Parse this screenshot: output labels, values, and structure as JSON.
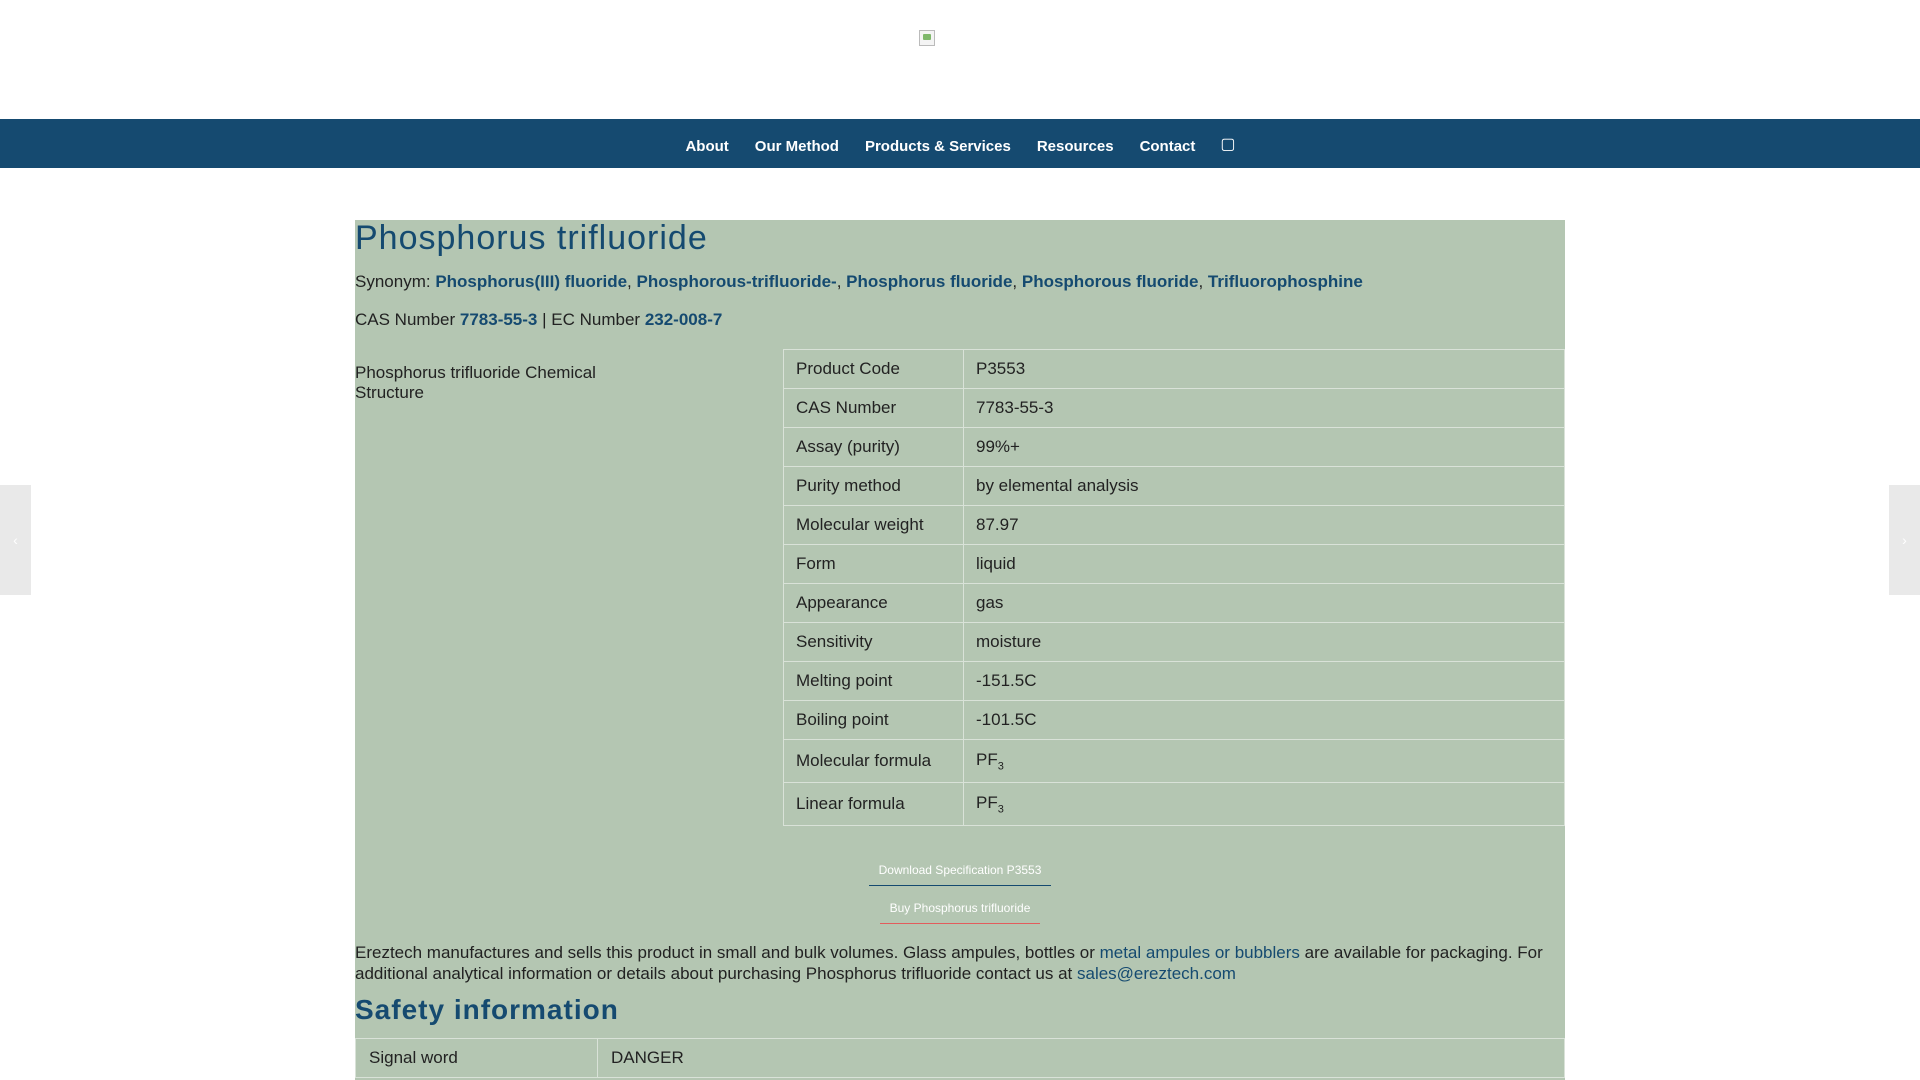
{
  "header": {
    "logo_icon": "broken-image-icon"
  },
  "nav": {
    "items": [
      "About",
      "Our Method",
      "Products & Services",
      "Resources",
      "Contact"
    ],
    "search_icon": "search-icon"
  },
  "product": {
    "title": "Phosphorus trifluoride",
    "synonym_label": "Synonym:",
    "synonyms": [
      "Phosphorus(III) fluoride",
      "Phosphorous-trifluoride-",
      "Phosphorus fluoride",
      "Phosphorous fluoride",
      "Trifluorophosphine"
    ],
    "cas_label": "CAS Number",
    "cas_value": "7783-55-3",
    "ec_label": "EC Number",
    "ec_value": "232-008-7",
    "structure_alt": "Phosphorus trifluoride Chemical Structure"
  },
  "properties": [
    {
      "key": "Product Code",
      "value": "P3553"
    },
    {
      "key": "CAS Number",
      "value": "7783-55-3"
    },
    {
      "key": "Assay (purity)",
      "value": "99%+"
    },
    {
      "key": "Purity method",
      "value": "by elemental analysis"
    },
    {
      "key": "Molecular weight",
      "value": "87.97"
    },
    {
      "key": "Form",
      "value": "liquid"
    },
    {
      "key": "Appearance",
      "value": "gas"
    },
    {
      "key": "Sensitivity",
      "value": "moisture"
    },
    {
      "key": "Melting point",
      "value": "-151.5C"
    },
    {
      "key": "Boiling point",
      "value": "-101.5C"
    }
  ],
  "formulas": [
    {
      "key": "Molecular formula",
      "base": "PF",
      "sub": "3"
    },
    {
      "key": "Linear formula",
      "base": "PF",
      "sub": "3"
    }
  ],
  "buttons": {
    "download": "Download Specification P3553",
    "buy": "Buy Phosphorus trifluoride"
  },
  "description": {
    "part1": "Ereztech manufactures and sells this product in small and bulk volumes. Glass ampules, bottles or ",
    "link1": "metal ampules or bubblers",
    "part2": " are available for packaging. For additional analytical information or details about purchasing Phosphorus trifluoride contact us at ",
    "email": "sales@ereztech.com"
  },
  "safety": {
    "heading": "Safety information",
    "rows": [
      {
        "key": "Signal word",
        "value": "DANGER"
      }
    ]
  }
}
